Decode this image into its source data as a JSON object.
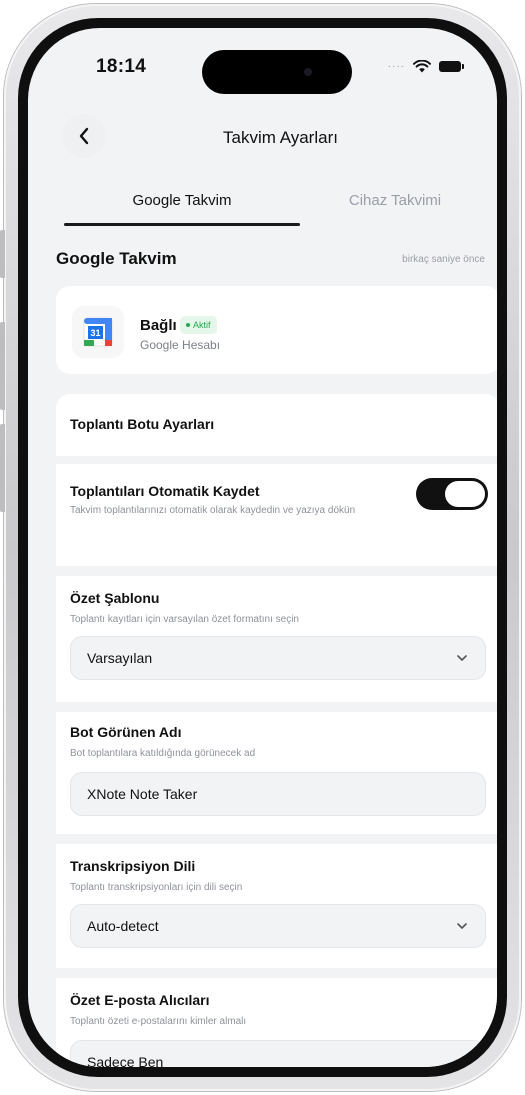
{
  "status_bar": {
    "time": "18:14"
  },
  "nav": {
    "title": "Takvim Ayarları"
  },
  "tabs": [
    {
      "label": "Google Takvim",
      "active": true
    },
    {
      "label": "Cihaz Takvimi",
      "active": false
    }
  ],
  "section": {
    "title": "Google Takvim",
    "last_sync": "birkaç saniye önce"
  },
  "account": {
    "status": "Bağlı",
    "badge": "Aktif",
    "provider": "Google Hesabı",
    "icon_day": "31"
  },
  "bot_settings": {
    "title": "Toplantı Botu Ayarları",
    "auto_record": {
      "title": "Toplantıları Otomatik Kaydet",
      "description": "Takvim toplantılarınızı otomatik olarak kaydedin ve yazıya dökün",
      "enabled": true
    },
    "summary_template": {
      "title": "Özet Şablonu",
      "description": "Toplantı kayıtları için varsayılan özet formatını seçin",
      "value": "Varsayılan"
    },
    "bot_name": {
      "title": "Bot Görünen Adı",
      "description": "Bot toplantılara katıldığında görünecek ad",
      "value": "XNote Note Taker"
    },
    "transcription_language": {
      "title": "Transkripsiyon Dili",
      "description": "Toplantı transkripsiyonları için dili seçin",
      "value": "Auto-detect"
    },
    "summary_recipients": {
      "title": "Özet E-posta Alıcıları",
      "description": "Toplantı özeti e-postalarını kimler almalı",
      "value": "Sadece Ben"
    }
  },
  "colors": {
    "accent": "#111111",
    "active_badge_bg": "#e5f7ea",
    "active_badge_text": "#22a94d",
    "background": "#f2f3f5"
  }
}
